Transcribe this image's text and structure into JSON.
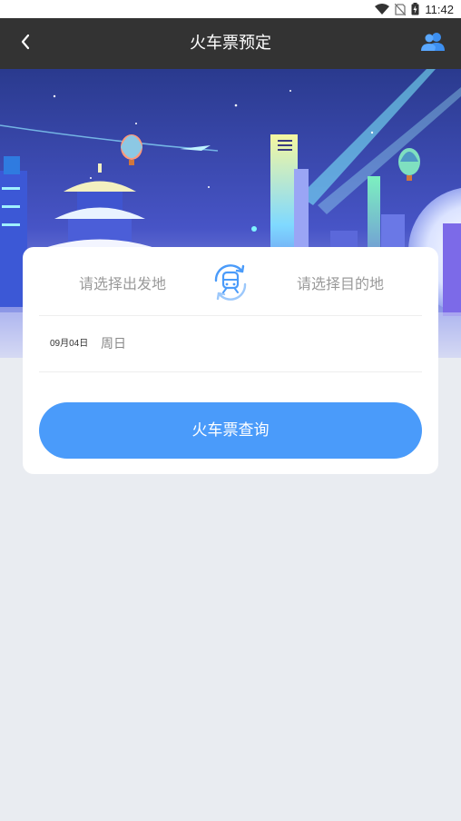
{
  "status_bar": {
    "time": "11:42",
    "icons": [
      "wifi-icon",
      "no-sim-icon",
      "battery-charging-icon"
    ]
  },
  "header": {
    "title": "火车票预定",
    "back_icon": "chevron-left-icon",
    "user_icon": "user-group-icon"
  },
  "search": {
    "from_placeholder": "请选择出发地",
    "to_placeholder": "请选择目的地",
    "swap_icon": "train-swap-icon",
    "date": "09月04日",
    "weekday": "周日",
    "query_label": "火车票查询"
  },
  "colors": {
    "header_bg": "#333333",
    "accent": "#4a9bfa",
    "page_bg": "#e9ecf1"
  }
}
